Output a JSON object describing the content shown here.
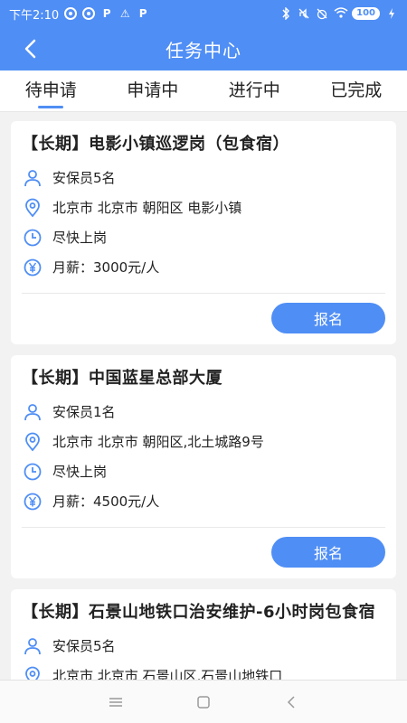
{
  "status_bar": {
    "time": "下午2:10",
    "battery": "100",
    "app_icons": [
      "pinwheel-icon",
      "pinwheel-icon",
      "p-icon",
      "warning-icon",
      "p-icon"
    ],
    "p_glyph": "P",
    "warn_glyph": "⚠",
    "right_icons": [
      "bluetooth-icon",
      "mute-icon",
      "alarm-off-icon",
      "wifi-icon",
      "battery-icon",
      "charging-icon"
    ]
  },
  "header": {
    "title": "任务中心",
    "back_icon": "chevron-left-icon"
  },
  "tabs": [
    {
      "label": "待申请",
      "active": true
    },
    {
      "label": "申请中",
      "active": false
    },
    {
      "label": "进行中",
      "active": false
    },
    {
      "label": "已完成",
      "active": false
    }
  ],
  "cards": [
    {
      "title": "【长期】电影小镇巡逻岗（包食宿）",
      "people": "安保员5名",
      "location": " 北京市 北京市 朝阳区 电影小镇",
      "time": "尽快上岗",
      "salary": "月薪：3000元/人",
      "button": "报名"
    },
    {
      "title": "【长期】中国蓝星总部大厦",
      "people": "安保员1名",
      "location": " 北京市 北京市 朝阳区,北土城路9号",
      "time": "尽快上岗",
      "salary": "月薪：4500元/人",
      "button": "报名"
    },
    {
      "title": "【长期】石景山地铁口治安维护-6小时岗包食宿",
      "people": "安保员5名",
      "location": " 北京市 北京市 石景山区,石景山地铁口",
      "time": "",
      "salary": "",
      "button": ""
    }
  ],
  "nav_bar": {
    "icons": [
      "menu-icon",
      "home-square-icon",
      "back-triangle-icon"
    ]
  },
  "colors": {
    "primary": "#4f8ef5",
    "background": "#f2f2f2",
    "icon": "#4f8ef5"
  }
}
